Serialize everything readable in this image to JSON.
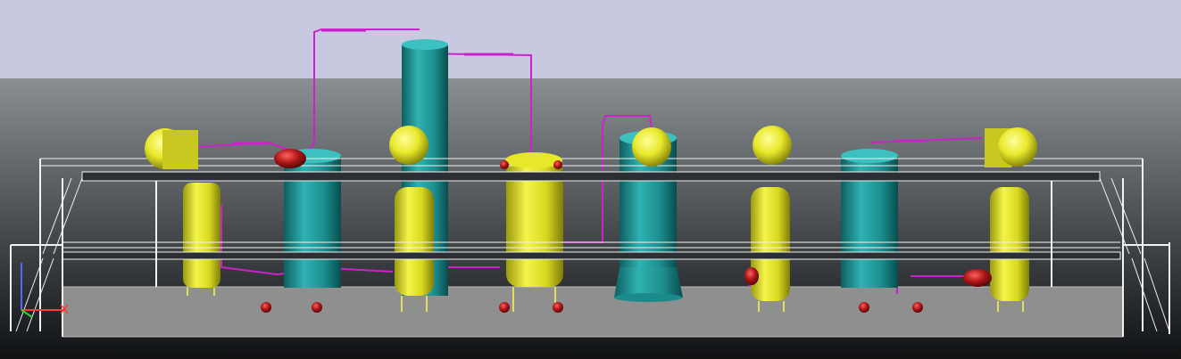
{
  "viewport": {
    "background_sky": "#c8c8e0",
    "background_ground_top": "#8a8f93",
    "background_ground_bottom": "#101214"
  },
  "colors": {
    "yellow_vessel": "#e6e62a",
    "teal_vessel": "#1f9a9a",
    "pipe": "#cc22cc",
    "pump": "#b01818",
    "structure": "#f2f2f2",
    "deck": "#2b2f33",
    "floor": "#8f8f8f"
  },
  "scene_objects": [
    "platform-structure",
    "upper-deck",
    "lower-deck",
    "ground-slab",
    "stairs-left",
    "stairs-right",
    "tall-column",
    "vertical-vessel",
    "horizontal-drum",
    "centrifugal-pump",
    "process-pipe"
  ],
  "ucs_icon": "ucs-axis-icon"
}
